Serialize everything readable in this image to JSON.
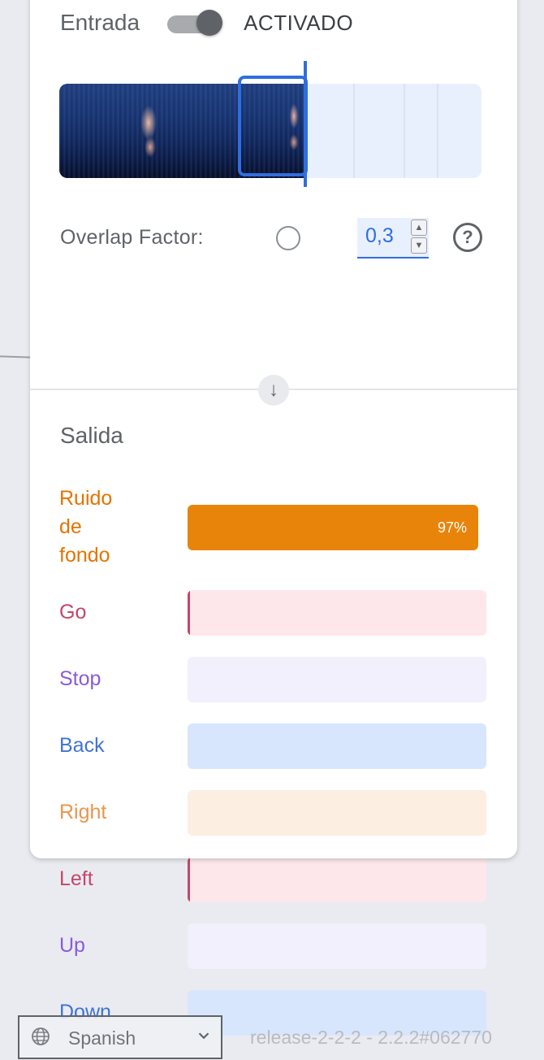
{
  "input": {
    "title": "Entrada",
    "toggle_state": "ACTIVADO",
    "toggle_on": true,
    "overlap_label": "Overlap Factor:",
    "overlap_value": "0,3",
    "help_icon": "question-circle-icon"
  },
  "output": {
    "title": "Salida",
    "rows": [
      {
        "label": "Ruido de fondo",
        "lines": [
          "Ruido",
          "de",
          "fondo"
        ],
        "percent_label": "97%",
        "percent": 97,
        "text_color": "#e37400",
        "track_color": "#fde8d2",
        "fill_color": "#e8840a"
      },
      {
        "label": "Go",
        "percent": 0.4,
        "text_color": "#c5466a",
        "track_color": "#fde7ea",
        "fill_color": "#c5466a"
      },
      {
        "label": "Stop",
        "percent": 0,
        "text_color": "#8a5cd6",
        "track_color": "#f2f0fc",
        "fill_color": "#8a5cd6"
      },
      {
        "label": "Back",
        "percent": 0,
        "text_color": "#3f74d6",
        "track_color": "#d8e6fd",
        "fill_color": "#3f74d6"
      },
      {
        "label": "Right",
        "percent": 0,
        "text_color": "#e8964d",
        "track_color": "#fdeee2",
        "fill_color": "#e8964d"
      },
      {
        "label": "Left",
        "percent": 0.4,
        "text_color": "#c5466a",
        "track_color": "#fde7ea",
        "fill_color": "#c5466a"
      },
      {
        "label": "Up",
        "percent": 0,
        "text_color": "#8a5cd6",
        "track_color": "#f2f0fc",
        "fill_color": "#8a5cd6"
      },
      {
        "label": "Down",
        "percent": 0,
        "text_color": "#3f74d6",
        "track_color": "#d8e6fd",
        "fill_color": "#3f74d6"
      }
    ]
  },
  "footer": {
    "language": "Spanish",
    "version": "release-2-2-2 - 2.2.2#062770"
  },
  "colors": {
    "accent": "#2f6ee0",
    "background": "#e9ebf0"
  }
}
